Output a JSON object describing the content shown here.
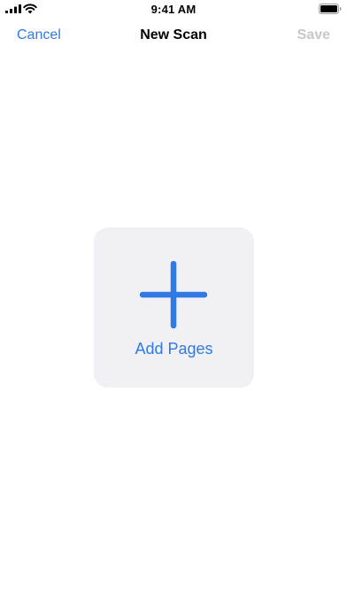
{
  "status_bar": {
    "time": "9:41 AM"
  },
  "nav": {
    "cancel_label": "Cancel",
    "title": "New Scan",
    "save_label": "Save"
  },
  "main": {
    "add_pages_label": "Add Pages"
  },
  "colors": {
    "accent": "#2f7ae5",
    "disabled": "#c7c7cc",
    "tile_background": "#f0f0f5"
  }
}
